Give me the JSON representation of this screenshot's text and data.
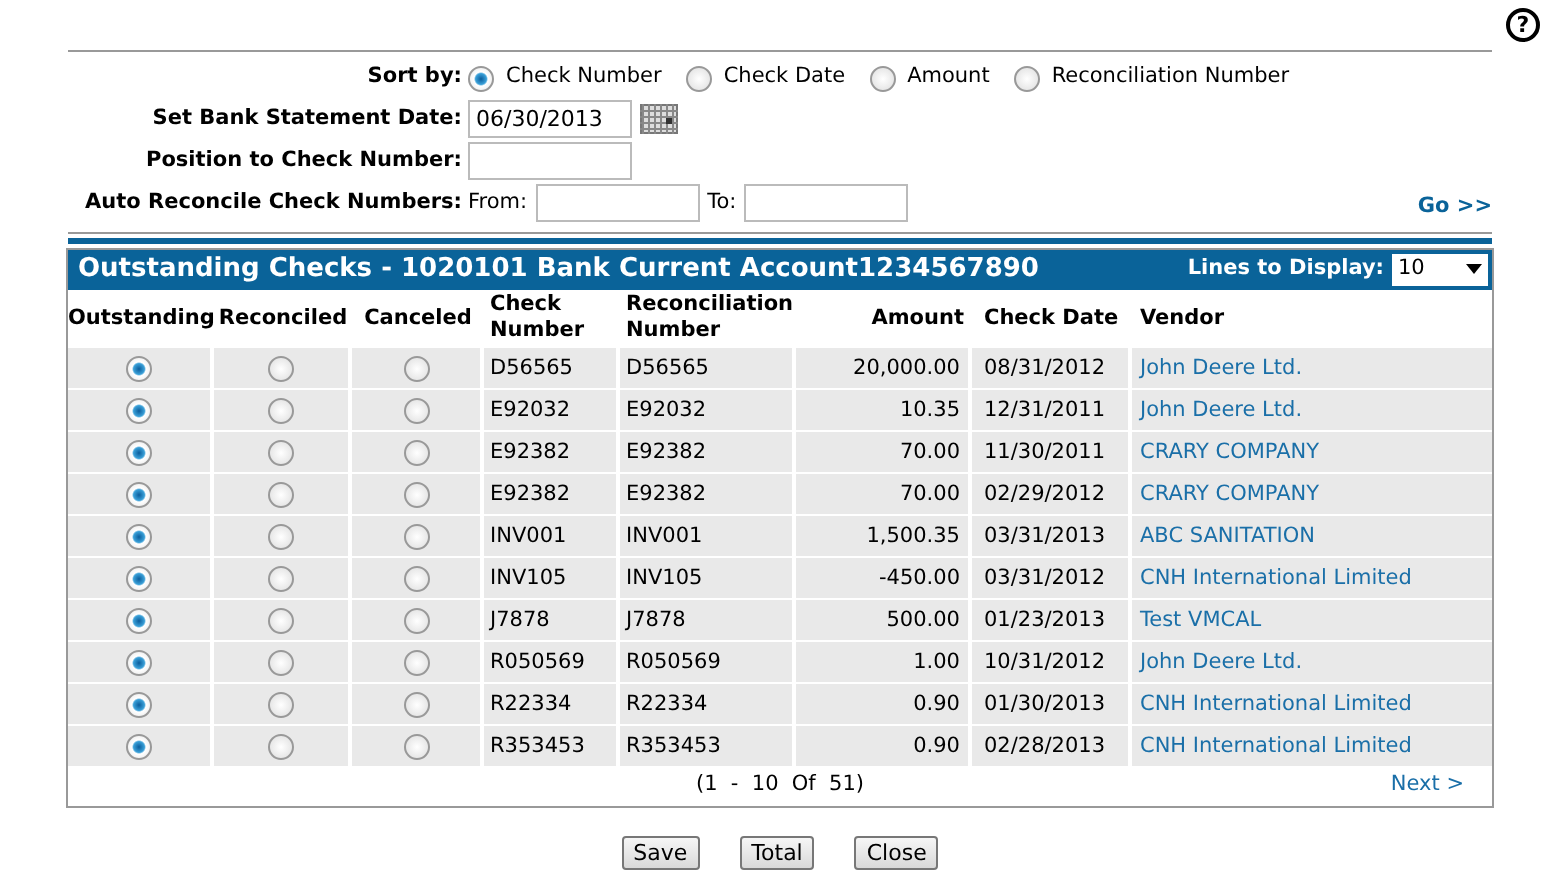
{
  "help": {
    "label": "?"
  },
  "sort_by": {
    "label": "Sort by:",
    "options": [
      {
        "label": "Check Number",
        "selected": true
      },
      {
        "label": "Check Date",
        "selected": false
      },
      {
        "label": "Amount",
        "selected": false
      },
      {
        "label": "Reconciliation Number",
        "selected": false
      }
    ]
  },
  "statement_date": {
    "label": "Set Bank Statement Date:",
    "value": "06/30/2013"
  },
  "position": {
    "label": "Position to Check Number:"
  },
  "auto_reconcile": {
    "label": "Auto Reconcile Check Numbers:",
    "from_label": "From:",
    "to_label": "To:",
    "go": "Go >>"
  },
  "table": {
    "title": "Outstanding Checks - 1020101 Bank Current Account1234567890",
    "lines_label": "Lines to Display:",
    "lines_value": "10",
    "columns": [
      "Outstanding",
      "Reconciled",
      "Canceled",
      "Check Number",
      "Reconciliation Number",
      "Amount",
      "Check Date",
      "Vendor"
    ],
    "rows": [
      {
        "outstanding": true,
        "reconciled": false,
        "canceled": false,
        "check_number": "D56565",
        "reconciliation_number": "D56565",
        "amount": "20,000.00",
        "check_date": "08/31/2012",
        "vendor": "John Deere Ltd."
      },
      {
        "outstanding": true,
        "reconciled": false,
        "canceled": false,
        "check_number": "E92032",
        "reconciliation_number": "E92032",
        "amount": "10.35",
        "check_date": "12/31/2011",
        "vendor": "John Deere Ltd."
      },
      {
        "outstanding": true,
        "reconciled": false,
        "canceled": false,
        "check_number": "E92382",
        "reconciliation_number": "E92382",
        "amount": "70.00",
        "check_date": "11/30/2011",
        "vendor": "CRARY COMPANY"
      },
      {
        "outstanding": true,
        "reconciled": false,
        "canceled": false,
        "check_number": "E92382",
        "reconciliation_number": "E92382",
        "amount": "70.00",
        "check_date": "02/29/2012",
        "vendor": "CRARY COMPANY"
      },
      {
        "outstanding": true,
        "reconciled": false,
        "canceled": false,
        "check_number": "INV001",
        "reconciliation_number": "INV001",
        "amount": "1,500.35",
        "check_date": "03/31/2013",
        "vendor": "ABC SANITATION"
      },
      {
        "outstanding": true,
        "reconciled": false,
        "canceled": false,
        "check_number": "INV105",
        "reconciliation_number": "INV105",
        "amount": "-450.00",
        "check_date": "03/31/2012",
        "vendor": "CNH International Limited"
      },
      {
        "outstanding": true,
        "reconciled": false,
        "canceled": false,
        "check_number": "J7878",
        "reconciliation_number": "J7878",
        "amount": "500.00",
        "check_date": "01/23/2013",
        "vendor": "Test VMCAL"
      },
      {
        "outstanding": true,
        "reconciled": false,
        "canceled": false,
        "check_number": "R050569",
        "reconciliation_number": "R050569",
        "amount": "1.00",
        "check_date": "10/31/2012",
        "vendor": "John Deere Ltd."
      },
      {
        "outstanding": true,
        "reconciled": false,
        "canceled": false,
        "check_number": "R22334",
        "reconciliation_number": "R22334",
        "amount": "0.90",
        "check_date": "01/30/2013",
        "vendor": "CNH International Limited"
      },
      {
        "outstanding": true,
        "reconciled": false,
        "canceled": false,
        "check_number": "R353453",
        "reconciliation_number": "R353453",
        "amount": "0.90",
        "check_date": "02/28/2013",
        "vendor": "CNH International Limited"
      }
    ],
    "pagination": "(1  -  10  Of  51)",
    "next": "Next >"
  },
  "buttons": [
    "Save",
    "Total",
    "Close"
  ]
}
